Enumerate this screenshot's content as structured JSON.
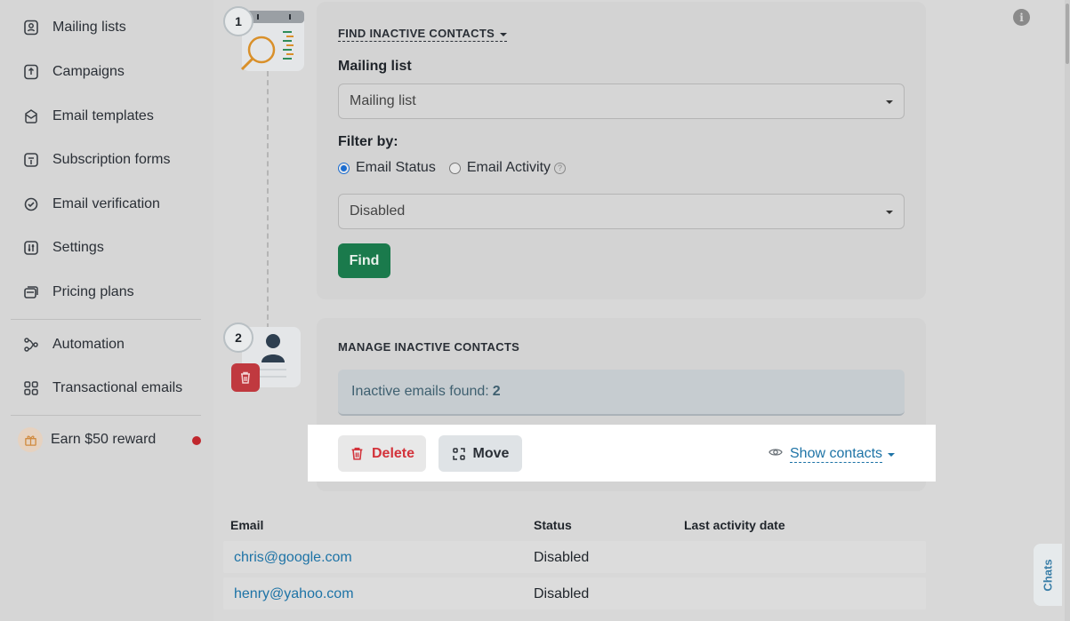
{
  "sidebar": {
    "items": [
      {
        "label": "Mailing lists",
        "icon": "mailing-list-icon"
      },
      {
        "label": "Campaigns",
        "icon": "campaign-icon"
      },
      {
        "label": "Email templates",
        "icon": "template-icon"
      },
      {
        "label": "Subscription forms",
        "icon": "form-icon"
      },
      {
        "label": "Email verification",
        "icon": "verification-icon"
      },
      {
        "label": "Settings",
        "icon": "settings-icon"
      },
      {
        "label": "Pricing plans",
        "icon": "pricing-icon"
      },
      {
        "label": "Automation",
        "icon": "automation-icon"
      },
      {
        "label": "Transactional emails",
        "icon": "grid-icon"
      }
    ],
    "reward": {
      "label": "Earn $50 reward",
      "icon": "gift-icon"
    }
  },
  "step1": {
    "number": "1",
    "title": "FIND INACTIVE CONTACTS",
    "mailing_list_label": "Mailing list",
    "mailing_list_value": "Mailing list",
    "filter_label": "Filter by:",
    "radio_status": "Email Status",
    "radio_activity": "Email Activity",
    "status_value": "Disabled",
    "find_button": "Find"
  },
  "step2": {
    "number": "2",
    "title": "MANAGE INACTIVE CONTACTS",
    "found_label": "Inactive emails found:",
    "found_count": "2",
    "delete_button": "Delete",
    "move_button": "Move",
    "show_contacts": "Show contacts"
  },
  "table": {
    "headers": [
      "Email",
      "Status",
      "Last activity date"
    ],
    "rows": [
      {
        "email": "chris@google.com",
        "status": "Disabled",
        "last_activity": ""
      },
      {
        "email": "henry@yahoo.com",
        "status": "Disabled",
        "last_activity": ""
      }
    ]
  },
  "chats_label": "Chats",
  "colors": {
    "accent_green": "#1a7a4c",
    "delete_red": "#d3333b",
    "link_blue": "#1d73a6"
  }
}
